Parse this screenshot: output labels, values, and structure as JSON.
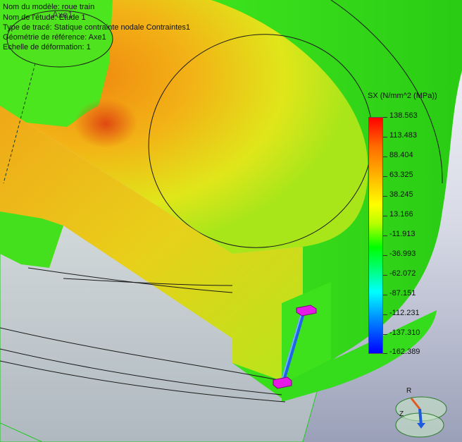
{
  "info": {
    "model_name": "Nom du modèle: roue train",
    "study_name": "Nom de l'étude: Etude 1",
    "plot_type": "Type de tracé: Statique contrainte nodale Contraintes1",
    "reference_geometry": "Géométrie de référence: Axe1",
    "deformation_scale": "Echelle de déformation: 1"
  },
  "axis_label": "Axe1",
  "legend": {
    "title": "SX (N/mm^2 (MPa))",
    "values": [
      "138.563",
      "113.483",
      "88.404",
      "63.325",
      "38.245",
      "13.166",
      "-11.913",
      "-36.993",
      "-62.072",
      "-87.151",
      "-112.231",
      "-137.310",
      "-162.389"
    ],
    "color_max": "#ff0000",
    "color_min": "#0000ff"
  },
  "triad": {
    "r_label": "R",
    "z_label": "Z",
    "r_color": "#e05a1e",
    "z_color": "#1e5adc"
  },
  "colors": {
    "background_top": "#f7f7fb",
    "background_bottom": "#9aa0b8",
    "body_green": "#33e61a",
    "body_yellow": "#e6e619",
    "fixture_magenta": "#e619e6"
  }
}
